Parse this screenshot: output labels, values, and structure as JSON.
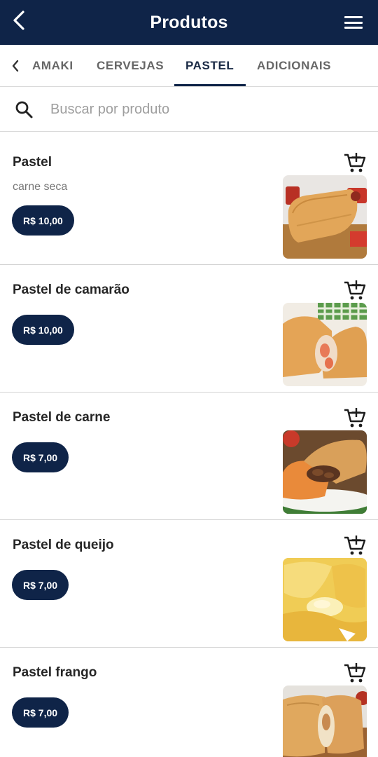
{
  "header": {
    "title": "Produtos",
    "back_icon": "chevron-left-icon",
    "menu_icon": "hamburger-menu-icon"
  },
  "tabs": {
    "scroll_icon": "chevron-left-icon",
    "items": [
      {
        "label": "AMAKI",
        "active": false
      },
      {
        "label": "CERVEJAS",
        "active": false
      },
      {
        "label": "PASTEL",
        "active": true
      },
      {
        "label": "ADICIONAIS",
        "active": false
      }
    ]
  },
  "search": {
    "placeholder": "Buscar por produto",
    "value": "",
    "icon": "search-icon"
  },
  "products": [
    {
      "name": "Pastel",
      "description": "carne seca",
      "price": "R$ 10,00",
      "cart_icon": "add-to-cart-icon",
      "image": "pastel-carne-seca-photo"
    },
    {
      "name": "Pastel de camarão",
      "description": "",
      "price": "R$ 10,00",
      "cart_icon": "add-to-cart-icon",
      "image": "pastel-camarao-photo"
    },
    {
      "name": "Pastel de carne",
      "description": "",
      "price": "R$ 7,00",
      "cart_icon": "add-to-cart-icon",
      "image": "pastel-carne-photo"
    },
    {
      "name": "Pastel de queijo",
      "description": "",
      "price": "R$ 7,00",
      "cart_icon": "add-to-cart-icon",
      "image": "pastel-queijo-photo"
    },
    {
      "name": "Pastel frango",
      "description": "",
      "price": "R$ 7,00",
      "cart_icon": "add-to-cart-icon",
      "image": "pastel-frango-photo"
    }
  ],
  "colors": {
    "primary": "#0f2448",
    "divider": "#d3d3d3",
    "muted_text": "#777777"
  }
}
